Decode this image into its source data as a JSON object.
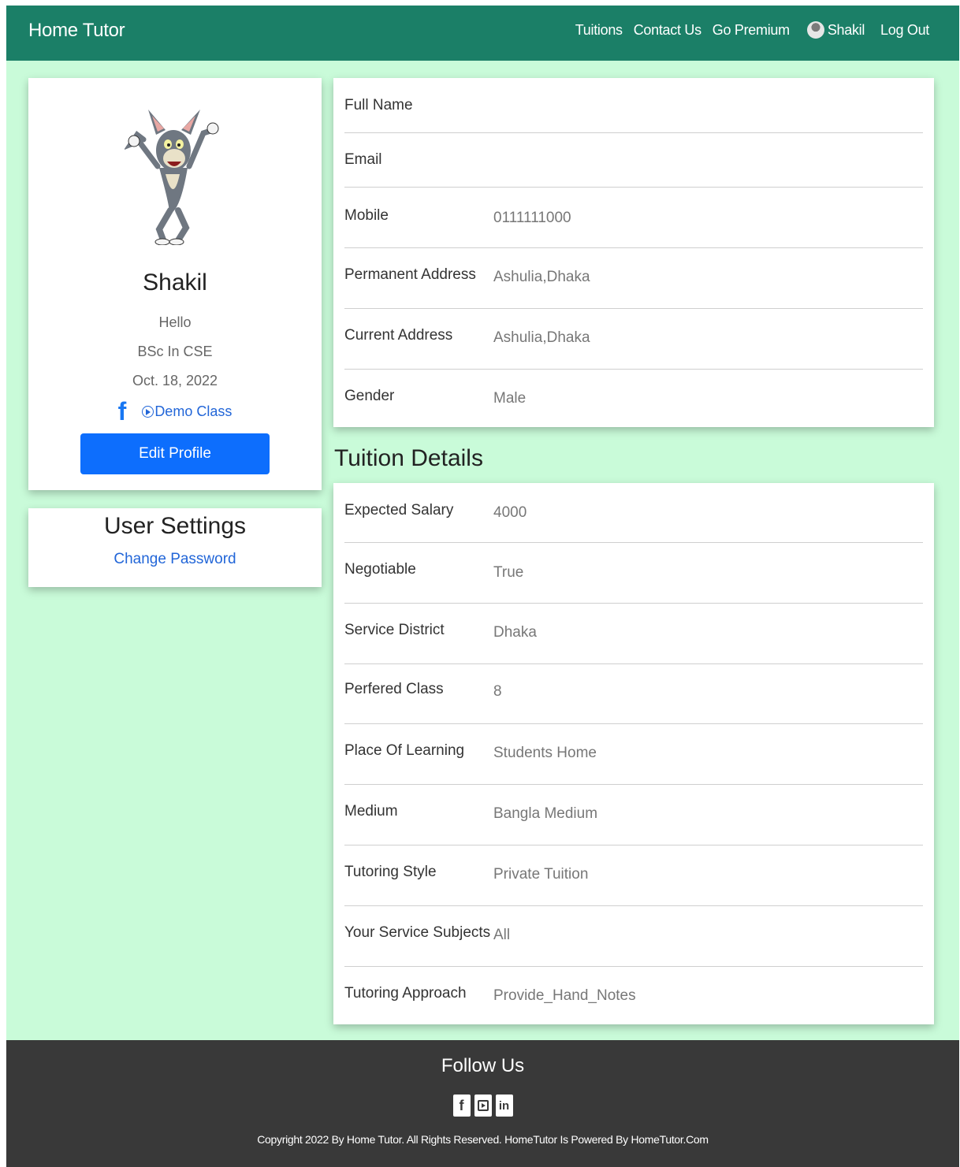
{
  "navbar": {
    "brand": "Home Tutor",
    "links": [
      "Tuitions",
      "Contact Us",
      "Go Premium"
    ],
    "user_name": "Shakil",
    "logout": "Log Out"
  },
  "profile": {
    "name": "Shakil",
    "bio": "Hello",
    "education": "BSc In CSE",
    "date": "Oct. 18, 2022",
    "facebook_icon": "f",
    "demo_class": "Demo Class",
    "edit_button": "Edit Profile"
  },
  "settings": {
    "title": "User Settings",
    "change_password": "Change Password"
  },
  "personal_info": [
    {
      "label": "Full Name",
      "value": ""
    },
    {
      "label": "Email",
      "value": ""
    },
    {
      "label": "Mobile",
      "value": "0111111000"
    },
    {
      "label": "Permanent Address",
      "value": "Ashulia,Dhaka"
    },
    {
      "label": "Current Address",
      "value": "Ashulia,Dhaka"
    },
    {
      "label": "Gender",
      "value": "Male"
    }
  ],
  "tuition_title": "Tuition Details",
  "tuition_details": [
    {
      "label": "Expected Salary",
      "value": "4000"
    },
    {
      "label": "Negotiable",
      "value": "True"
    },
    {
      "label": "Service District",
      "value": "Dhaka"
    },
    {
      "label": "Perfered Class",
      "value": "8"
    },
    {
      "label": "Place Of Learning",
      "value": "Students Home"
    },
    {
      "label": "Medium",
      "value": "Bangla Medium"
    },
    {
      "label": "Tutoring Style",
      "value": "Private Tuition"
    },
    {
      "label": "Your Service Subjects",
      "value": "All"
    },
    {
      "label": "Tutoring Approach",
      "value": "Provide_Hand_Notes"
    }
  ],
  "footer": {
    "follow": "Follow Us",
    "copyright": "Copyright 2022 By Home Tutor. All Rights Reserved. HomeTutor Is Powered By HomeTutor.Com",
    "icons": {
      "facebook": "f",
      "linkedin": "in"
    }
  },
  "colors": {
    "navbar": "#1b7f67",
    "background": "#c9fbd9",
    "primary_button": "#0d6efd",
    "link": "#2266d8",
    "footer": "#393939"
  }
}
